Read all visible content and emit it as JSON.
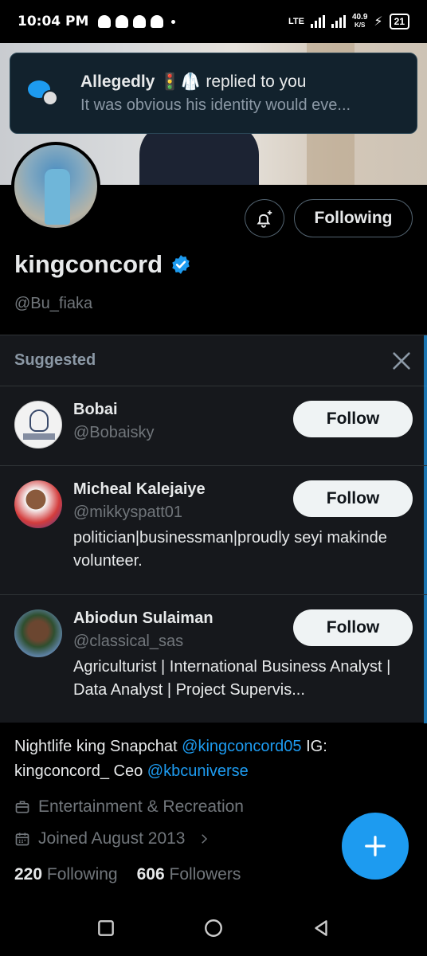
{
  "status": {
    "time": "10:04 PM",
    "network": "LTE",
    "speed_value": "40.9",
    "speed_unit": "K/S",
    "battery": "21"
  },
  "notification": {
    "user": "Allegedly",
    "emoji": "🚦🥼",
    "action": "replied to you",
    "body": "It was obvious his identity would eve..."
  },
  "profile": {
    "following_label": "Following",
    "display_name": "kingconcord",
    "handle": "@Bu_fiaka"
  },
  "suggested": {
    "title": "Suggested",
    "items": [
      {
        "name": "Bobai",
        "handle": "@Bobaisky",
        "bio": "",
        "follow_label": "Follow"
      },
      {
        "name": "Micheal Kalejaiye",
        "handle": "@mikkyspatt01",
        "bio": "politician|businessman|proudly seyi makinde volunteer.",
        "follow_label": "Follow"
      },
      {
        "name": "Abiodun Sulaiman",
        "handle": "@classical_sas",
        "bio": "Agriculturist | International Business Analyst | Data Analyst | Project Supervis...",
        "follow_label": "Follow"
      }
    ]
  },
  "bio": {
    "part1": "Nightlife king Snapchat ",
    "link1": "@kingconcord05",
    "part2": " IG: kingconcord_ Ceo ",
    "link2": "@kbcuniverse"
  },
  "meta": {
    "category": "Entertainment & Recreation",
    "joined": "Joined August 2013"
  },
  "counts": {
    "following_num": "220",
    "following_label": "Following",
    "followers_num": "606",
    "followers_label": "Followers"
  },
  "colors": {
    "accent": "#1d9bf0",
    "background": "#000000",
    "panel": "#16181c"
  }
}
